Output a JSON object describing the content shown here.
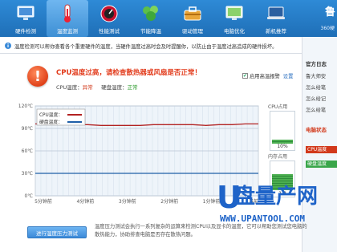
{
  "toolbar": {
    "items": [
      {
        "label": "硬件检测",
        "icon": "monitor-icon"
      },
      {
        "label": "温度监测",
        "icon": "thermometer-icon",
        "active": true
      },
      {
        "label": "性能测试",
        "icon": "speedometer-icon"
      },
      {
        "label": "节能降温",
        "icon": "leaf-icon"
      },
      {
        "label": "驱动管理",
        "icon": "toolbox-icon"
      },
      {
        "label": "电脑优化",
        "icon": "screen-icon"
      },
      {
        "label": "新机推荐",
        "icon": "laptop-icon"
      }
    ],
    "brand": "鲁",
    "brand_sub": "360硬"
  },
  "notice": {
    "text": "温度检测可以帮你查看各个重要硬件的温度，当硬件温度过高时会及时提醒你，以防止由于温度过高造成的硬件损坏。"
  },
  "warning": {
    "title": "CPU温度过高，请检查散热器或风扇是否正常！",
    "cpu_label": "CPU温度：",
    "cpu_status": "异常",
    "disk_label": "硬盘温度：",
    "disk_status": "正常",
    "alarm_label": "启用高温报警",
    "alarm_checked": true,
    "settings_link": "设置"
  },
  "chart_data": {
    "type": "line",
    "y_ticks": [
      "120℃",
      "90℃",
      "60℃",
      "30℃",
      "0℃"
    ],
    "ylim": [
      0,
      120
    ],
    "x_ticks": [
      "5分钟前",
      "4分钟前",
      "3分钟前",
      "2分钟前",
      "1分钟前",
      "当前"
    ],
    "legend": [
      {
        "name": "CPU温度",
        "color": "#b22222"
      },
      {
        "name": "硬盘温度",
        "color": "#1f5fa8"
      }
    ],
    "series": [
      {
        "name": "CPU温度",
        "values": [
          96,
          96,
          95,
          95,
          95,
          94,
          94,
          94,
          94,
          95,
          95,
          95,
          95,
          94,
          95,
          95,
          96,
          96
        ]
      },
      {
        "name": "硬盘温度",
        "values": [
          30,
          30,
          30,
          30,
          30,
          30,
          30,
          30,
          30,
          30,
          30,
          30,
          30,
          30,
          30,
          30,
          30,
          30
        ]
      }
    ]
  },
  "gauges": {
    "cpu": {
      "title": "CPU占用",
      "value": "10%",
      "fraction": 0.1
    },
    "memory": {
      "title": "内存占用",
      "value": "1.3",
      "fraction": 0.45
    }
  },
  "right_panel": {
    "title": "官方日志",
    "links": [
      "鲁大师安",
      "怎么给笔",
      "怎么给记",
      "怎么给笔"
    ],
    "status_title": "电脑状态",
    "bars": [
      {
        "label": "CPU温度",
        "color": "#d2391b"
      },
      {
        "label": "硬盘温度",
        "color": "#3aa64a"
      }
    ]
  },
  "bottom": {
    "button": "进行温度压力测试",
    "text": "温度压力测试会执行一系列复杂的运算来检测CPU以及显卡的温度，它可以帮助您测试您电脑的散热能力，协助排查电脑是否存在散热问题。"
  },
  "watermark": {
    "letter": "U",
    "chinese": "盘量产网",
    "url": "WWW.UPANTOOL.COM"
  }
}
